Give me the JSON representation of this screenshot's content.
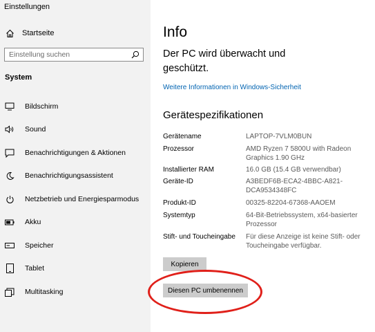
{
  "window": {
    "title": "Einstellungen"
  },
  "sidebar": {
    "home_label": "Startseite",
    "search_placeholder": "Einstellung suchen",
    "section_label": "System",
    "items": [
      {
        "label": "Bildschirm",
        "icon": "monitor-icon"
      },
      {
        "label": "Sound",
        "icon": "speaker-icon"
      },
      {
        "label": "Benachrichtigungen & Aktionen",
        "icon": "message-icon"
      },
      {
        "label": "Benachrichtigungsassistent",
        "icon": "moon-icon"
      },
      {
        "label": "Netzbetrieb und Energiesparmodus",
        "icon": "power-icon"
      },
      {
        "label": "Akku",
        "icon": "battery-icon"
      },
      {
        "label": "Speicher",
        "icon": "storage-icon"
      },
      {
        "label": "Tablet",
        "icon": "tablet-icon"
      },
      {
        "label": "Multitasking",
        "icon": "multitasking-icon"
      }
    ]
  },
  "main": {
    "title": "Info",
    "protection_status": "Der PC wird überwacht und geschützt.",
    "security_link": "Weitere Informationen in Windows-Sicherheit",
    "specs_heading": "Gerätespezifikationen",
    "specs": [
      {
        "label": "Gerätename",
        "value": "LAPTOP-7VLM0BUN"
      },
      {
        "label": "Prozessor",
        "value": "AMD Ryzen 7 5800U with Radeon Graphics 1.90 GHz"
      },
      {
        "label": "Installierter RAM",
        "value": "16.0 GB (15.4 GB verwendbar)"
      },
      {
        "label": "Geräte-ID",
        "value": "A3BEDF6B-ECA2-4BBC-A821-DCA9534348FC"
      },
      {
        "label": "Produkt-ID",
        "value": "00325-82204-67368-AAOEM"
      },
      {
        "label": "Systemtyp",
        "value": "64-Bit-Betriebssystem, x64-basierter Prozessor"
      },
      {
        "label": "Stift- und Toucheingabe",
        "value": "Für diese Anzeige ist keine Stift- oder Toucheingabe verfügbar."
      }
    ],
    "copy_button": "Kopieren",
    "rename_button": "Diesen PC umbenennen"
  },
  "colors": {
    "link": "#0063b1",
    "highlight_circle": "#e0201a",
    "sidebar_bg": "#f2f2f2",
    "button_bg": "#cccccc"
  }
}
